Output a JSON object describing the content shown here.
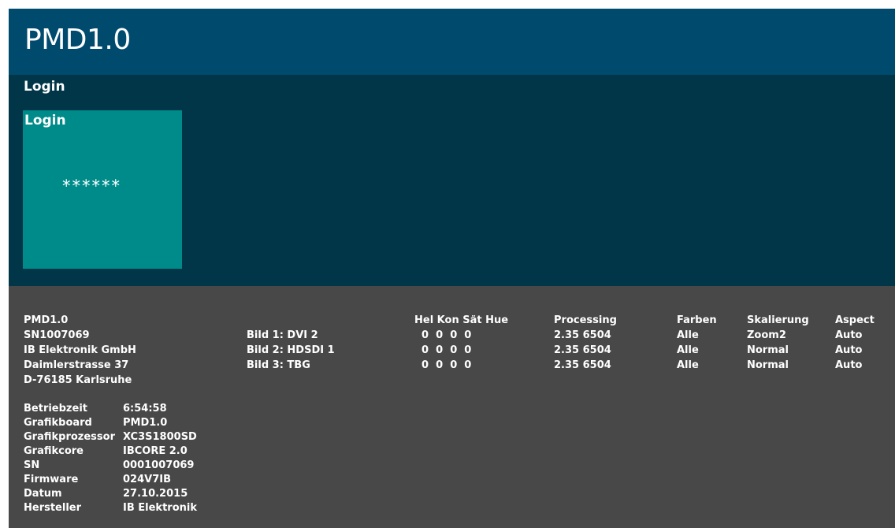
{
  "app": {
    "title": "PMD1.0"
  },
  "section": {
    "title": "Login"
  },
  "login_tile": {
    "label": "Login",
    "value": "******"
  },
  "device": {
    "lines": [
      "PMD1.0",
      "SN1007069",
      "IB Elektronik GmbH",
      "Daimlerstrasse 37",
      "D-76185 Karlsruhe"
    ]
  },
  "specs": [
    {
      "label": "Betriebzeit",
      "value": "6:54:58"
    },
    {
      "label": "Grafikboard",
      "value": "PMD1.0"
    },
    {
      "label": "Grafikprozessor",
      "value": "XC3S1800SD"
    },
    {
      "label": "Grafikcore",
      "value": "IBCORE 2.0"
    },
    {
      "label": "SN",
      "value": "0001007069"
    },
    {
      "label": "Firmware",
      "value": "024V7IB"
    },
    {
      "label": "Datum",
      "value": "27.10.2015"
    },
    {
      "label": "Hersteller",
      "value": "IB Elektronik"
    }
  ],
  "images_table": {
    "headers": {
      "adjust": "Hel Kon Sät Hue",
      "processing": "Processing",
      "farben": "Farben",
      "skalierung": "Skalierung",
      "aspect": "Aspect"
    },
    "rows": [
      {
        "name": "Bild 1: DVI 2",
        "adjust": "0  0  0  0",
        "processing": "2.35 6504",
        "farben": "Alle",
        "skalierung": "Zoom2",
        "aspect": "Auto"
      },
      {
        "name": "Bild 2: HDSDI 1",
        "adjust": "0  0  0  0",
        "processing": "2.35 6504",
        "farben": "Alle",
        "skalierung": "Normal",
        "aspect": "Auto"
      },
      {
        "name": "Bild 3: TBG",
        "adjust": "0  0  0  0",
        "processing": "2.35 6504",
        "farben": "Alle",
        "skalierung": "Normal",
        "aspect": "Auto"
      }
    ]
  },
  "colors": {
    "titlebar": "#004a6e",
    "main": "#003648",
    "tile": "#008b8b",
    "info": "#484848",
    "text": "#ffffff"
  }
}
